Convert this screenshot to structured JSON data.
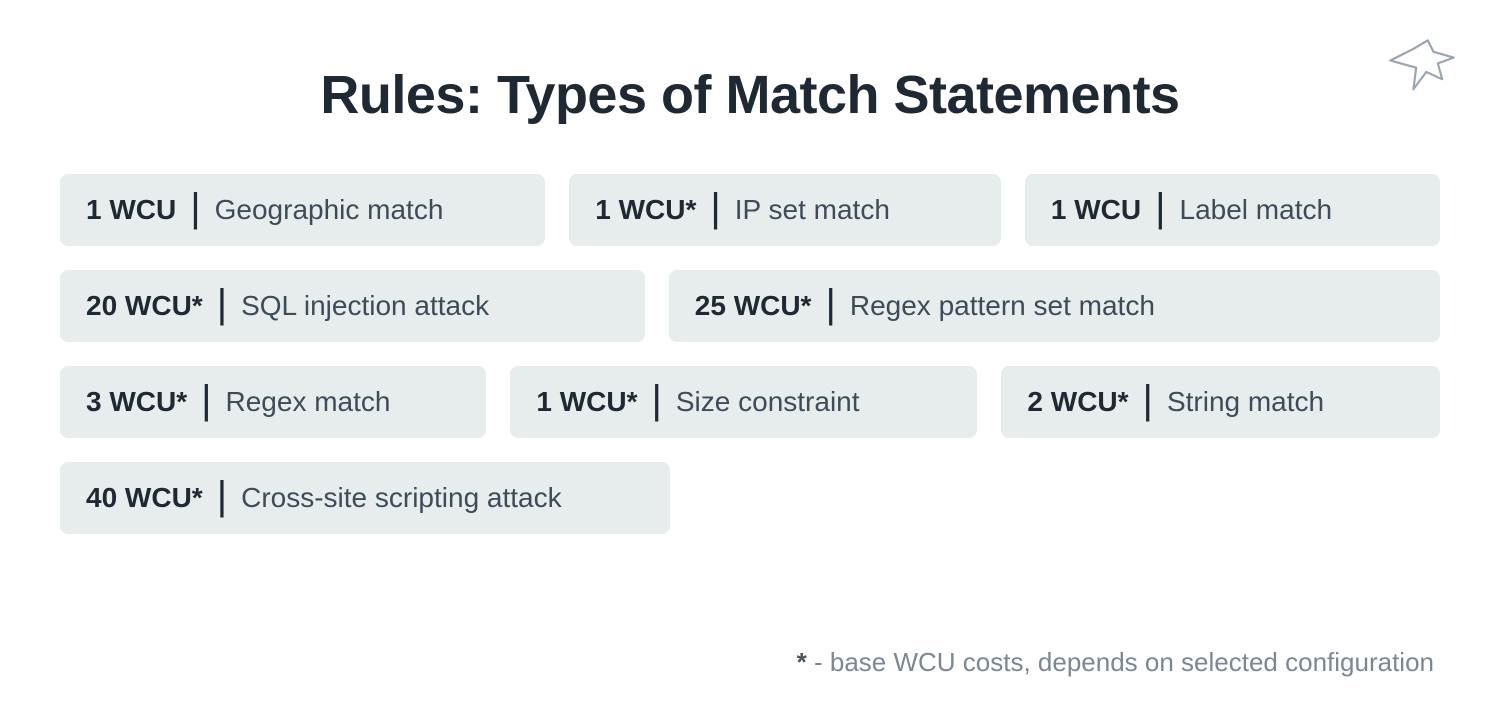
{
  "title": "Rules: Types of Match Statements",
  "footnote_star": "*",
  "footnote_text": " - base WCU costs, depends on selected configuration",
  "rows": [
    [
      {
        "wcu": "1 WCU",
        "label": "Geographic match"
      },
      {
        "wcu": "1 WCU*",
        "label": "IP set match"
      },
      {
        "wcu": "1 WCU",
        "label": "Label match"
      }
    ],
    [
      {
        "wcu": "20 WCU*",
        "label": "SQL injection attack"
      },
      {
        "wcu": "25 WCU*",
        "label": "Regex pattern set match"
      }
    ],
    [
      {
        "wcu": "3 WCU*",
        "label": "Regex match"
      },
      {
        "wcu": "1 WCU*",
        "label": "Size constraint"
      },
      {
        "wcu": "2 WCU*",
        "label": "String match"
      }
    ],
    [
      {
        "wcu": "40 WCU*",
        "label": "Cross-site scripting attack"
      }
    ]
  ]
}
